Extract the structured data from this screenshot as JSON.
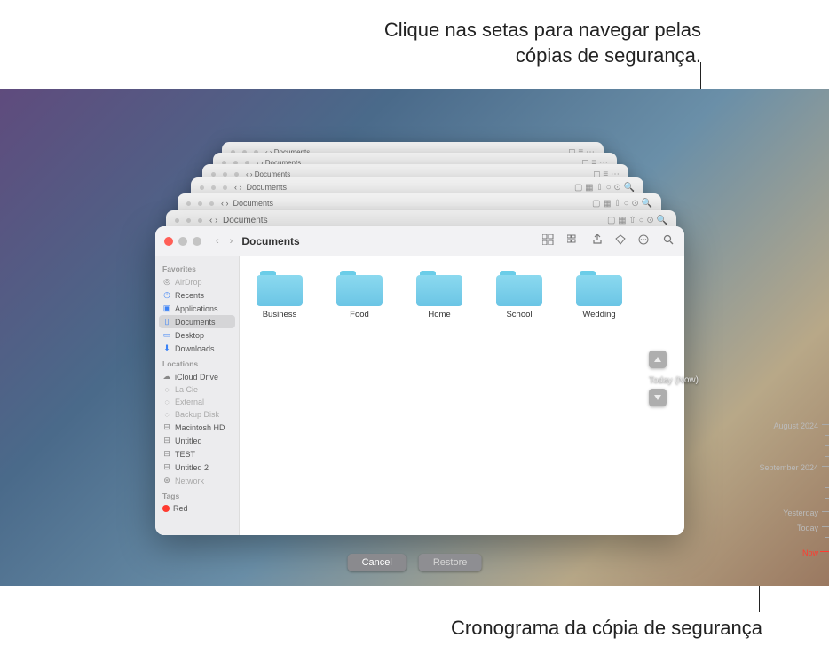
{
  "annotations": {
    "top": "Clique nas setas para navegar pelas cópias de segurança.",
    "bottom": "Cronograma da cópia de segurança"
  },
  "window": {
    "title": "Documents"
  },
  "sidebar": {
    "favorites_head": "Favorites",
    "items": [
      {
        "label": "AirDrop",
        "icon": "airdrop-icon",
        "cls": "icon-gray",
        "disabled": true
      },
      {
        "label": "Recents",
        "icon": "clock-icon",
        "cls": "icon-blue"
      },
      {
        "label": "Applications",
        "icon": "apps-icon",
        "cls": "icon-blue"
      },
      {
        "label": "Documents",
        "icon": "doc-icon",
        "cls": "icon-blue",
        "selected": true
      },
      {
        "label": "Desktop",
        "icon": "desktop-icon",
        "cls": "icon-blue"
      },
      {
        "label": "Downloads",
        "icon": "downloads-icon",
        "cls": "icon-blue"
      }
    ],
    "locations_head": "Locations",
    "locations": [
      {
        "label": "iCloud Drive",
        "icon": "cloud-icon",
        "cls": "icon-gray"
      },
      {
        "label": "La Cie",
        "icon": "disk-icon",
        "cls": "icon-gray",
        "disabled": true
      },
      {
        "label": "External",
        "icon": "disk-icon",
        "cls": "icon-gray",
        "disabled": true
      },
      {
        "label": "Backup Disk",
        "icon": "disk-icon",
        "cls": "icon-gray",
        "disabled": true
      },
      {
        "label": "Macintosh HD",
        "icon": "hd-icon",
        "cls": "icon-gray"
      },
      {
        "label": "Untitled",
        "icon": "hd-icon",
        "cls": "icon-gray"
      },
      {
        "label": "TEST",
        "icon": "hd-icon",
        "cls": "icon-gray"
      },
      {
        "label": "Untitled 2",
        "icon": "hd-icon",
        "cls": "icon-gray"
      },
      {
        "label": "Network",
        "icon": "network-icon",
        "cls": "icon-gray",
        "disabled": true
      }
    ],
    "tags_head": "Tags",
    "tags": [
      {
        "label": "Red",
        "color": "tag-red"
      }
    ]
  },
  "folders": [
    {
      "label": "Business"
    },
    {
      "label": "Food"
    },
    {
      "label": "Home"
    },
    {
      "label": "School"
    },
    {
      "label": "Wedding"
    }
  ],
  "timemachine": {
    "current": "Today (Now)"
  },
  "buttons": {
    "cancel": "Cancel",
    "restore": "Restore"
  },
  "timeline": {
    "aug": "August 2024",
    "sep": "September 2024",
    "yesterday": "Yesterday",
    "today": "Today",
    "now": "Now"
  }
}
